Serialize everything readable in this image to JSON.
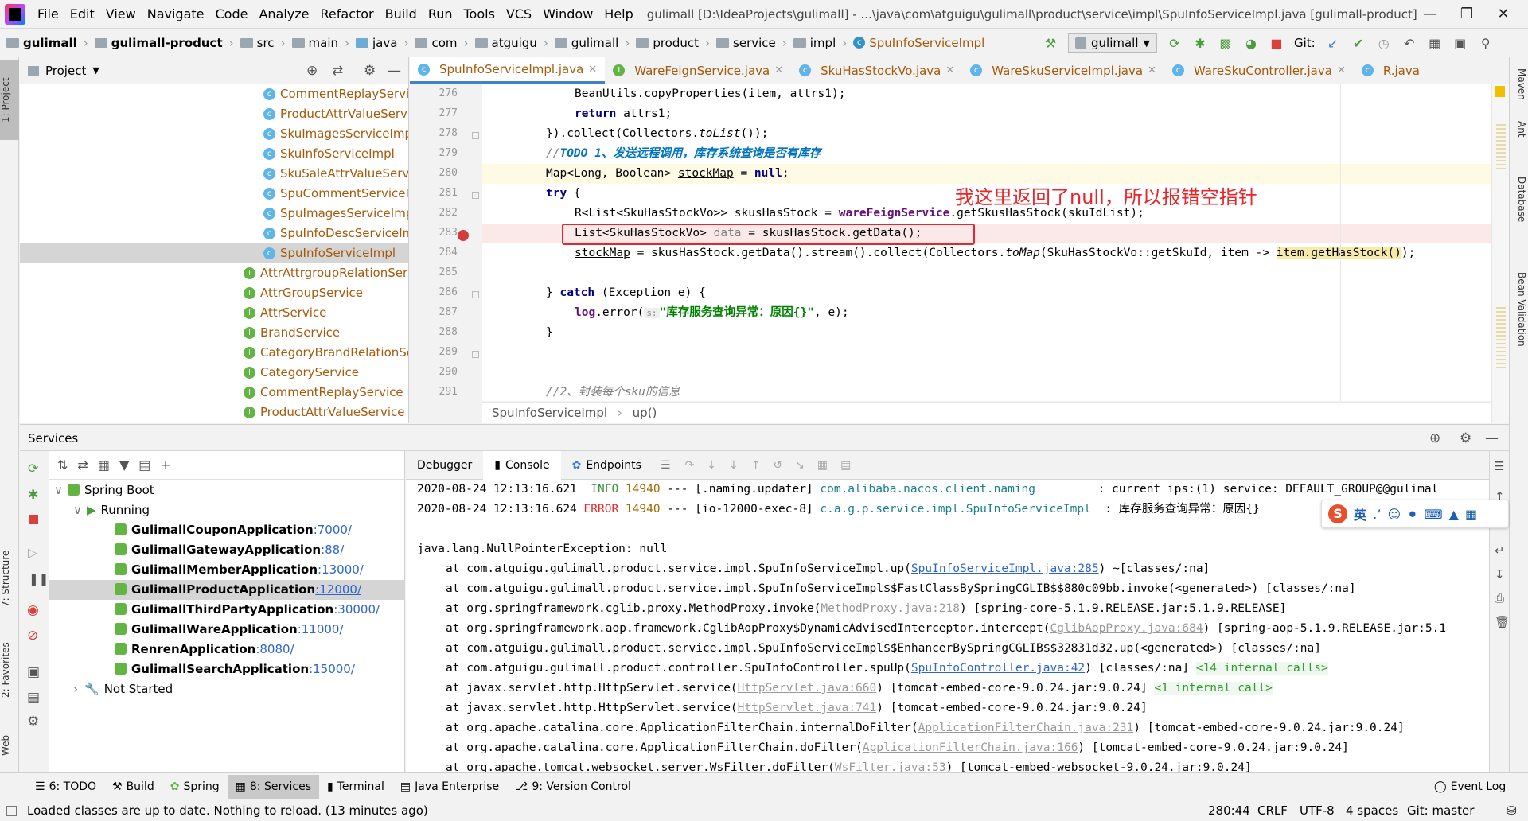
{
  "app": {
    "menus": [
      "File",
      "Edit",
      "View",
      "Navigate",
      "Code",
      "Analyze",
      "Refactor",
      "Build",
      "Run",
      "Tools",
      "VCS",
      "Window",
      "Help"
    ],
    "window_title": "gulimall [D:\\IdeaProjects\\gulimall] - ...\\java\\com\\atguigu\\gulimall\\product\\service\\impl\\SpuInfoServiceImpl.java [gulimall-product]"
  },
  "breadcrumb": [
    "gulimall",
    "gulimall-product",
    "src",
    "main",
    "java",
    "com",
    "atguigu",
    "gulimall",
    "product",
    "service",
    "impl",
    "SpuInfoServiceImpl"
  ],
  "toolbar": {
    "run_config": "gulimall",
    "git_label": "Git:"
  },
  "project": {
    "header": "Project",
    "items": [
      {
        "label": "CommentReplayServic",
        "kind": "class"
      },
      {
        "label": "ProductAttrValueServi",
        "kind": "class"
      },
      {
        "label": "SkuImagesServiceImpl",
        "kind": "class"
      },
      {
        "label": "SkuInfoServiceImpl",
        "kind": "class"
      },
      {
        "label": "SkuSaleAttrValueServi",
        "kind": "class"
      },
      {
        "label": "SpuCommentServiceIr",
        "kind": "class"
      },
      {
        "label": "SpuImagesServiceImp",
        "kind": "class"
      },
      {
        "label": "SpuInfoDescServiceIm",
        "kind": "class"
      },
      {
        "label": "SpuInfoServiceImpl",
        "kind": "class"
      },
      {
        "label": "AttrAttrgroupRelationSer",
        "kind": "interface"
      },
      {
        "label": "AttrGroupService",
        "kind": "interface"
      },
      {
        "label": "AttrService",
        "kind": "interface"
      },
      {
        "label": "BrandService",
        "kind": "interface"
      },
      {
        "label": "CategoryBrandRelationSe",
        "kind": "interface"
      },
      {
        "label": "CategoryService",
        "kind": "interface"
      },
      {
        "label": "CommentReplayService",
        "kind": "interface"
      },
      {
        "label": "ProductAttrValueService",
        "kind": "interface"
      }
    ]
  },
  "editor": {
    "tabs": [
      "SpuInfoServiceImpl.java",
      "WareFeignService.java",
      "SkuHasStockVo.java",
      "WareSkuServiceImpl.java",
      "WareSkuController.java",
      "R.java"
    ],
    "line_numbers": [
      "276",
      "277",
      "278",
      "279",
      "280",
      "281",
      "282",
      "283",
      "284",
      "285",
      "286",
      "287",
      "288",
      "289",
      "290",
      "291"
    ],
    "lines": {
      "l276": "BeanUtils.copyProperties(item, attrs1);",
      "l277_kw": "return",
      "l277_rest": " attrs1;",
      "l278": "}).collect(Collectors.",
      "l278_it": "toList",
      "l278_end": "());",
      "l279_a": "//",
      "l279_todo": "TODO 1、发送远程调用，库存系统查询是否有库存",
      "l280_a": "Map<Long, Boolean> ",
      "l280_var": "stockMap",
      "l280_b": " = ",
      "l280_null": "null",
      "l280_c": ";",
      "l281_kw": "try",
      "l281_rest": " {",
      "l282_a": "R<List<SkuHasStockVo>> skusHasStock = ",
      "l282_fld": "wareFeignService",
      "l282_b": ".getSkusHasStock(skuIdList);",
      "l283_a": "List<SkuHasStockVo> ",
      "l283_var": "data",
      "l283_b": " = skusHasStock.getData();",
      "l284_var": "stockMap",
      "l284_a": " = skusHasStock.getData().stream().collect(Collectors.",
      "l284_it": "toMap",
      "l284_b": "(SkuHasStockVo::getSkuId, item -> ",
      "l284_hl": "item.getHasStock()",
      "l284_c": ");",
      "l286_a": "} ",
      "l286_kw": "catch",
      "l286_b": " (Exception e) {",
      "l287_fld": "log",
      "l287_a": ".error(",
      "l287_hint": "s:",
      "l287_str": "\"库存服务查询异常：原因{}\"",
      "l287_b": ", e);",
      "l288": "}",
      "l291": "//2、封装每个sku的信息"
    },
    "annotation": "我这里返回了null，所以报错空指针",
    "crumb": [
      "SpuInfoServiceImpl",
      "up()"
    ]
  },
  "services": {
    "header": "Services",
    "root": "Spring Boot",
    "running": "Running",
    "apps": [
      {
        "name": "GulimallCouponApplication",
        "port": ":7000/"
      },
      {
        "name": "GulimallGatewayApplication",
        "port": ":88/"
      },
      {
        "name": "GulimallMemberApplication",
        "port": ":13000/"
      },
      {
        "name": "GulimallProductApplication",
        "port": ":12000/"
      },
      {
        "name": "GulimallThirdPartyApplication",
        "port": ":30000/"
      },
      {
        "name": "GulimallWareApplication",
        "port": ":11000/"
      },
      {
        "name": "RenrenApplication",
        "port": ":8080/"
      },
      {
        "name": "GulimallSearchApplication",
        "port": ":15000/"
      }
    ],
    "not_started": "Not Started"
  },
  "console": {
    "tabs": [
      "Debugger",
      "Console",
      "Endpoints"
    ],
    "log1": {
      "ts": "2020-08-24 12:13:16.621",
      "level": "INFO",
      "pid": "14940",
      "sep": "---",
      "thread": "[.naming.updater]",
      "logger": "com.alibaba.nacos.client.naming",
      "msg": ": current ips:(1) service: DEFAULT_GROUP@@gulimal"
    },
    "log2": {
      "ts": "2020-08-24 12:13:16.624",
      "level": "ERROR",
      "pid": "14940",
      "sep": "---",
      "thread": "[io-12000-exec-8]",
      "logger": "c.a.g.p.service.impl.SpuInfoServiceImpl",
      "msg": ": 库存服务查询异常：原因{}"
    },
    "exception": "java.lang.NullPointerException: null",
    "trace": [
      {
        "pre": "at com.atguigu.gulimall.product.service.impl.SpuInfoServiceImpl.up(",
        "link": "SpuInfoServiceImpl.java:285",
        "post": ") ~[classes/:na]",
        "style": "link"
      },
      {
        "pre": "at com.atguigu.gulimall.product.service.impl.SpuInfoServiceImpl$$FastClassBySpringCGLIB$$880c09bb.invoke(<generated>) [classes/:na]",
        "link": "",
        "post": "",
        "style": ""
      },
      {
        "pre": "at org.springframework.cglib.proxy.MethodProxy.invoke(",
        "link": "MethodProxy.java:218",
        "post": ") [spring-core-5.1.9.RELEASE.jar:5.1.9.RELEASE]",
        "style": "grey"
      },
      {
        "pre": "at org.springframework.aop.framework.CglibAopProxy$DynamicAdvisedInterceptor.intercept(",
        "link": "CglibAopProxy.java:684",
        "post": ") [spring-aop-5.1.9.RELEASE.jar:5.1",
        "style": "grey"
      },
      {
        "pre": "at com.atguigu.gulimall.product.service.impl.SpuInfoServiceImpl$$EnhancerBySpringCGLIB$$32831d32.up(<generated>) [classes/:na]",
        "link": "",
        "post": "",
        "style": ""
      },
      {
        "pre": "at com.atguigu.gulimall.product.controller.SpuInfoController.spuUp(",
        "link": "SpuInfoController.java:42",
        "post": ") [classes/:na] ",
        "internal": "<14 internal calls>",
        "style": "link"
      },
      {
        "pre": "at javax.servlet.http.HttpServlet.service(",
        "link": "HttpServlet.java:660",
        "post": ") [tomcat-embed-core-9.0.24.jar:9.0.24] ",
        "internal": "<1 internal call>",
        "style": "grey"
      },
      {
        "pre": "at javax.servlet.http.HttpServlet.service(",
        "link": "HttpServlet.java:741",
        "post": ") [tomcat-embed-core-9.0.24.jar:9.0.24]",
        "style": "grey"
      },
      {
        "pre": "at org.apache.catalina.core.ApplicationFilterChain.internalDoFilter(",
        "link": "ApplicationFilterChain.java:231",
        "post": ") [tomcat-embed-core-9.0.24.jar:9.0.24]",
        "style": "grey"
      },
      {
        "pre": "at org.apache.catalina.core.ApplicationFilterChain.doFilter(",
        "link": "ApplicationFilterChain.java:166",
        "post": ") [tomcat-embed-core-9.0.24.jar:9.0.24]",
        "style": "grey"
      },
      {
        "pre": "at org.apache.tomcat.websocket.server.WsFilter.doFilter(",
        "link": "WsFilter.java:53",
        "post": ") [tomcat-embed-websocket-9.0.24.jar:9.0.24]",
        "style": "grey"
      }
    ]
  },
  "bottom_tabs": [
    "6: TODO",
    "Build",
    "Spring",
    "8: Services",
    "Terminal",
    "Java Enterprise",
    "9: Version Control"
  ],
  "event_log": "Event Log",
  "status": {
    "message": "Loaded classes are up to date. Nothing to reload. (13 minutes ago)",
    "position": "280:44",
    "line_sep": "CRLF",
    "encoding": "UTF-8",
    "indent": "4 spaces",
    "git": "Git: master"
  },
  "side_tabs": {
    "left": [
      "1: Project",
      "7: Structure",
      "2: Favorites",
      "Web"
    ],
    "right": [
      "Maven",
      "Ant",
      "Database",
      "Bean Validation"
    ]
  },
  "ime": {
    "label": "英"
  },
  "colors": {
    "accent": "#4083c9",
    "error": "#e8262a",
    "info": "#3c8e3c",
    "link": "#2f65ca"
  }
}
